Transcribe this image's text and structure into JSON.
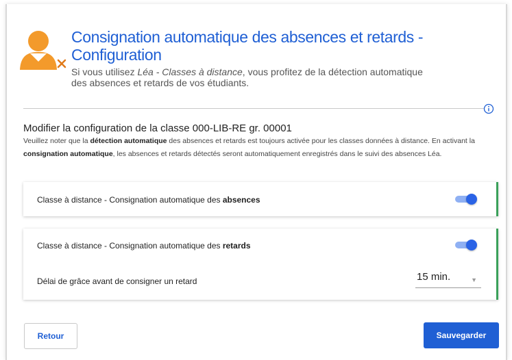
{
  "header": {
    "title": "Consignation automatique des absences et retards - Configuration",
    "subtitle_before": "Si vous utilisez ",
    "subtitle_em": "Léa - Classes à distance",
    "subtitle_after": ", vous profitez de la détection automatique des absences et retards de vos étudiants.",
    "icon": "user-cross-icon"
  },
  "section": {
    "title": "Modifier la configuration de la classe 000-LIB-RE gr. 00001",
    "desc": {
      "p1": "Veuillez noter que la ",
      "b1": "détection automatique",
      "p2": " des absences et retards est toujours activée pour les classes données à distance. En activant la ",
      "b2": "consignation automatique",
      "p3": ", les absences et retards détectés seront automatiquement enregistrés dans le suivi des absences Léa."
    }
  },
  "absences": {
    "label_prefix": "Classe à distance - Consignation automatique des ",
    "label_bold": "absences",
    "enabled": true
  },
  "retards": {
    "label_prefix": "Classe à distance - Consignation automatique des ",
    "label_bold": "retards",
    "enabled": true,
    "grace_label": "Délai de grâce avant de consigner un retard",
    "grace_value": "15 min."
  },
  "buttons": {
    "back": "Retour",
    "save": "Sauvegarder"
  },
  "colors": {
    "accent": "#1f5fd4",
    "icon_orange": "#f39a2b",
    "toggle_on": "#2a63e6",
    "card_border": "#3aa05a"
  }
}
